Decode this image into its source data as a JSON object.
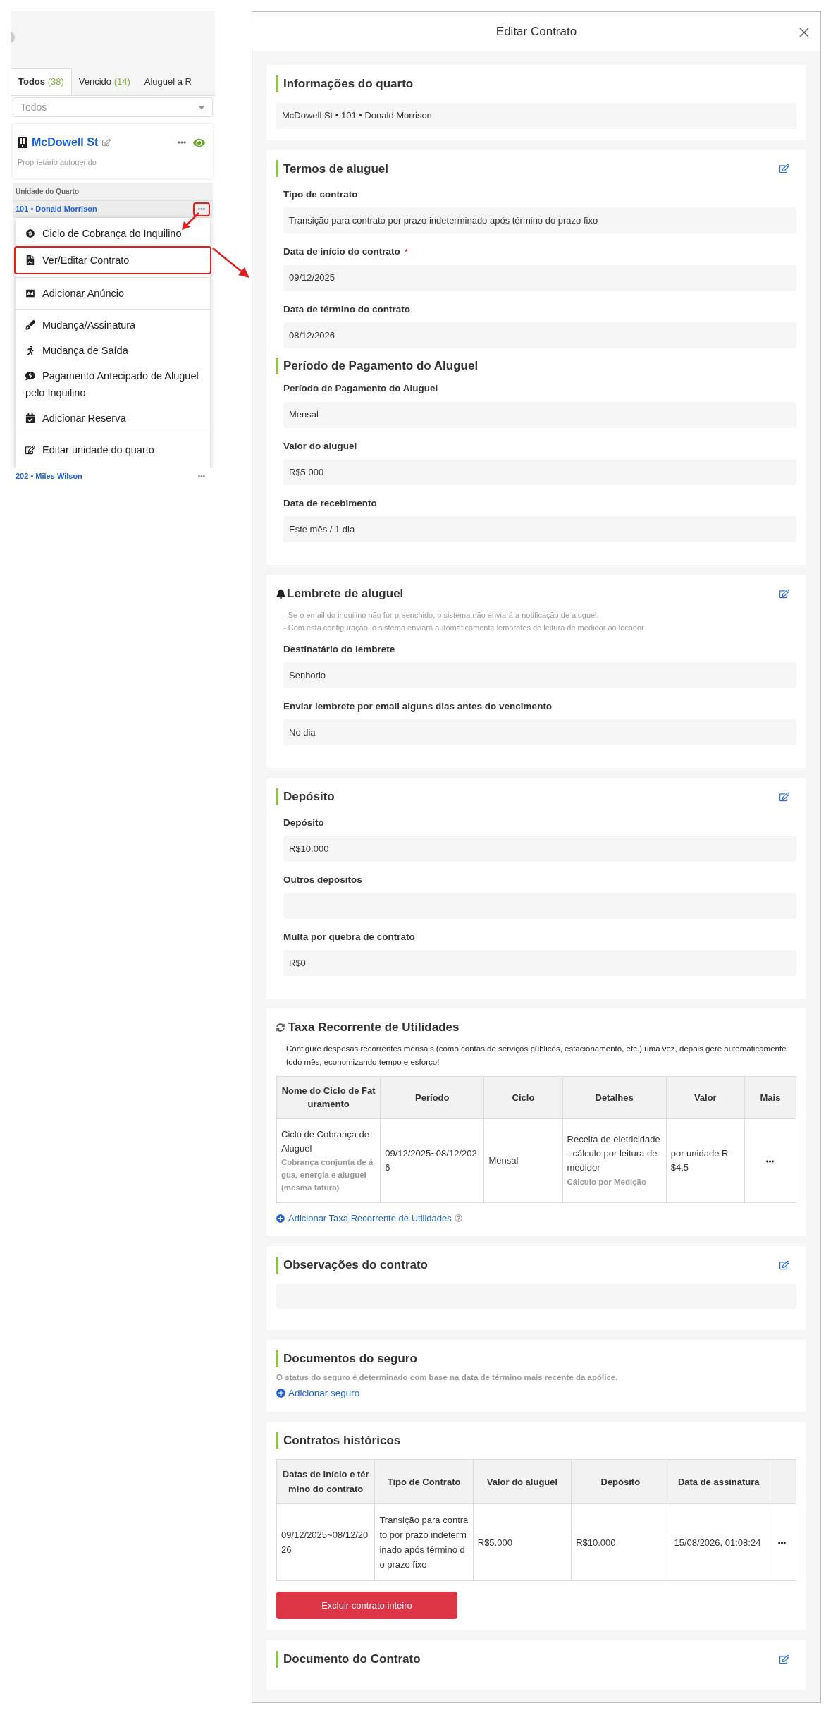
{
  "sidebar": {
    "tabs": [
      {
        "label": "Todos",
        "count": "(38)",
        "selected": true
      },
      {
        "label": "Vencido",
        "count": "(14)",
        "selected": false
      },
      {
        "label": "Aluguel a R",
        "selected": false
      }
    ],
    "filter": {
      "placeholder": "Todos"
    },
    "property": {
      "name": "McDowell St",
      "subtitle": "Proprietário autogerido"
    },
    "units_header": "Unidade do Quarto",
    "units": [
      {
        "label": "101 • Donald Morrison",
        "highlighted": true,
        "menu_open": true
      },
      {
        "label": "202 • Miles Wilson",
        "highlighted": false,
        "menu_open": false
      }
    ],
    "menu": {
      "groups": [
        [
          {
            "label": "Ciclo de Cobrança do Inquilino",
            "highlighted": false
          },
          {
            "label": "Ver/Editar Contrato",
            "highlighted": true
          }
        ],
        [
          {
            "label": "Adicionar Anúncio",
            "highlighted": false
          }
        ],
        [
          {
            "label": "Mudança/Assinatura",
            "highlighted": false
          },
          {
            "label": "Mudança de Saída",
            "highlighted": false
          },
          {
            "label": "Pagamento Antecipado de Aluguel pelo Inquilino",
            "highlighted": false
          },
          {
            "label": "Adicionar Reserva",
            "highlighted": false
          }
        ],
        [
          {
            "label": "Editar unidade do quarto",
            "highlighted": false
          }
        ]
      ]
    }
  },
  "modal": {
    "title": "Editar Contrato",
    "sections": [
      {
        "kind": "info",
        "title": "Informações do quarto",
        "editable": false,
        "value": "McDowell St • 101 • Donald Morrison"
      },
      {
        "kind": "fields",
        "title": "Termos de aluguel",
        "editable": true,
        "fields": [
          {
            "kind": "field",
            "label": "Tipo de contrato",
            "value": "Transição para contrato por prazo indeterminado após término do prazo fixo"
          },
          {
            "kind": "field",
            "label": "Data de início do contrato",
            "required_mark": "*",
            "value": "09/12/2025"
          },
          {
            "kind": "field",
            "label": "Data de término do contrato",
            "value": "08/12/2026"
          },
          {
            "kind": "heading",
            "label": "Período de Pagamento do Aluguel"
          },
          {
            "kind": "field",
            "label": "Período de Pagamento do Aluguel",
            "value": "Mensal"
          },
          {
            "kind": "field",
            "label": "Valor do aluguel",
            "value": "R$5.000"
          },
          {
            "kind": "field",
            "label": "Data de recebimento",
            "value": "Este mês / 1 dia"
          }
        ]
      },
      {
        "kind": "reminder",
        "title": "Lembrete de aluguel",
        "editable": true,
        "notes": [
          "- Se o email do inquilino não for preenchido, o sistema não enviará a notificação de aluguel.",
          "- Com esta configuração, o sistema enviará automaticamente lembretes de leitura de medidor ao locador"
        ],
        "fields": [
          {
            "kind": "field",
            "label": "Destinatário do lembrete",
            "value": "Senhorio"
          },
          {
            "kind": "field",
            "label": "Enviar lembrete por email alguns dias antes do vencimento",
            "value": "No dia"
          }
        ]
      },
      {
        "kind": "fields",
        "title": "Depósito",
        "editable": true,
        "fields": [
          {
            "kind": "field",
            "label": "Depósito",
            "value": "R$10.000"
          },
          {
            "kind": "field",
            "label": "Outros depósitos"
          },
          {
            "kind": "field",
            "label": "Multa por quebra de contrato",
            "value": "R$0"
          }
        ]
      },
      {
        "kind": "utilities",
        "title": "Taxa Recorrente de Utilidades",
        "editable": false,
        "description": "Configure despesas recorrentes mensais (como contas de serviços públicos, estacionamento, etc.) uma vez, depois gere automaticamente todo mês, economizando tempo e esforço!",
        "columns": [
          "Nome do Ciclo de Faturamento",
          "Período",
          "Ciclo",
          "Detalhes",
          "Valor",
          "Mais"
        ],
        "rows": [
          {
            "name": "Ciclo de Cobrança de Aluguel",
            "name_note": "Cobrança conjunta de água, energia e aluguel (mesma fatura)",
            "period": "09/12/2025~08/12/2026",
            "cycle": "Mensal",
            "details": "Receita de eletricidade - cálculo por leitura de medidor",
            "details_note": "Cálculo por Medição",
            "value": "por unidade R$4,5"
          }
        ],
        "add_link": "Adicionar Taxa Recorrente de Utilidades"
      },
      {
        "kind": "notes",
        "title": "Observações do contrato",
        "editable": true
      },
      {
        "kind": "insurance",
        "title": "Documentos do seguro",
        "editable": false,
        "description": "O status do seguro é determinado com base na data de término mais recente da apólice.",
        "add_link": "Adicionar seguro"
      },
      {
        "kind": "history",
        "title": "Contratos históricos",
        "editable": false,
        "columns": [
          "Datas de início e término do contrato",
          "Tipo de Contrato",
          "Valor do aluguel",
          "Depósito",
          "Data de assinatura"
        ],
        "rows": [
          {
            "cells": [
              "09/12/2025~08/12/2026",
              "Transição para contrato por prazo indeterminado após término do prazo fixo",
              "R$5.000",
              "R$10.000",
              "15/08/2026, 01:08:24"
            ]
          }
        ],
        "delete_button": "Excluir contrato inteiro"
      },
      {
        "kind": "document",
        "title": "Documento do Contrato",
        "editable": true
      }
    ]
  }
}
